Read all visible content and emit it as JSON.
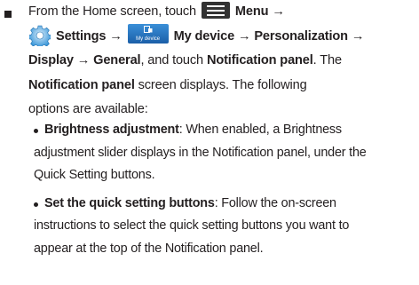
{
  "step": {
    "l1_a": "From the Home screen, touch",
    "menu_label": "Menu",
    "arrow": "→",
    "settings_label": "Settings",
    "mydevice_icon_caption": "My device",
    "mydevice_label": "My device",
    "personalization_label": "Personalization",
    "display_label": "Display",
    "general_label": "General",
    "l3_mid": ", and touch",
    "notification_panel_label": "Notification panel",
    "l3_end": ". The",
    "l4_end": "screen displays. The following",
    "l5": "options are available:"
  },
  "options": [
    {
      "title": "Brightness adjustment",
      "lines": [
        ": When enabled, a Brightness",
        "adjustment slider displays in the Notification panel, under the",
        "Quick Setting buttons."
      ]
    },
    {
      "title": "Set the quick setting buttons",
      "lines": [
        ": Follow the on-screen",
        "instructions to select the quick setting buttons you want to",
        "appear at the top of the Notification panel."
      ]
    }
  ],
  "colors": {
    "text": "#231f20",
    "icon_dark": "#333333",
    "mydevice_blue": "#1b5fa8",
    "gear_blue": "#2b8fd6"
  },
  "icons": [
    "menu-icon",
    "gear-icon",
    "my-device-icon"
  ]
}
